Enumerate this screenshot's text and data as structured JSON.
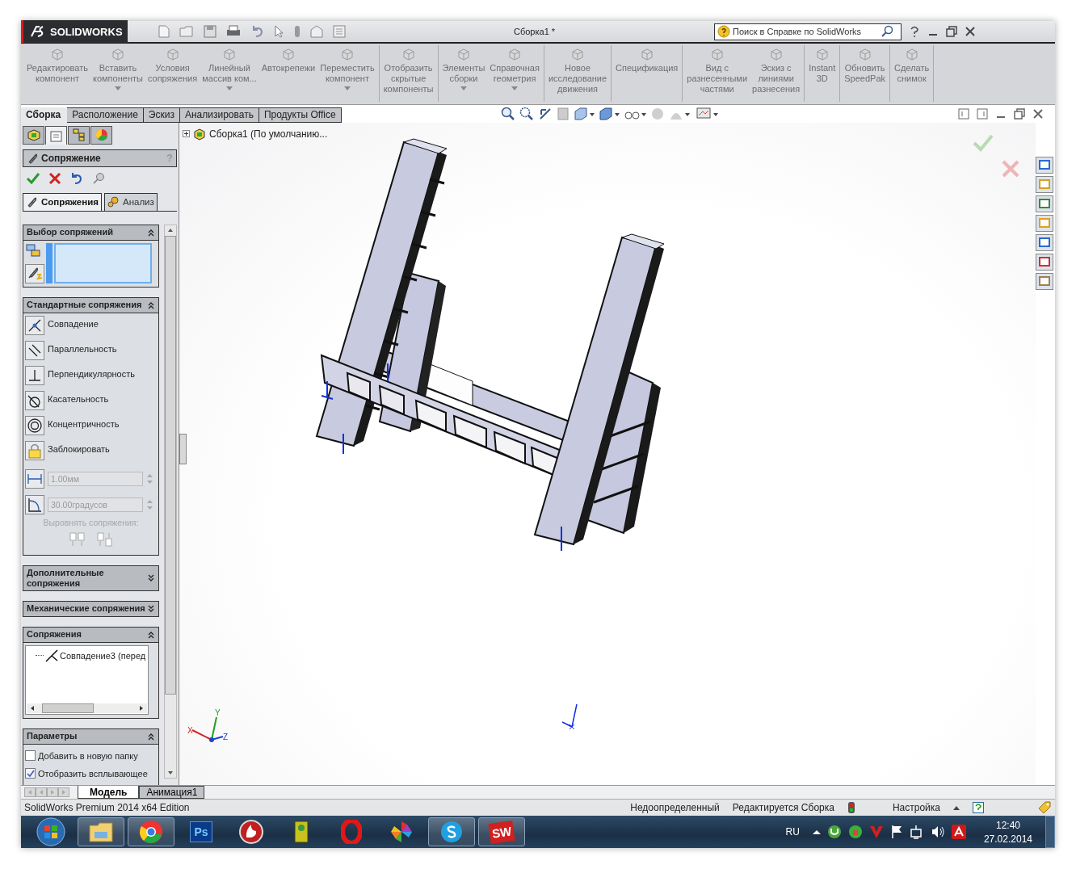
{
  "app_logo": "SOLIDWORKS",
  "window": {
    "title": "Сборка1 *"
  },
  "help_search": {
    "placeholder": "Поиск в Справке по SolidWorks"
  },
  "ribbon": [
    [
      {
        "label": "Редактировать\nкомпонент",
        "dropdown": false
      },
      {
        "label": "Вставить\nкомпоненты",
        "dropdown": true
      },
      {
        "label": "Условия\nсопряжения",
        "dropdown": false
      },
      {
        "label": "Линейный\nмассив ком...",
        "dropdown": true
      },
      {
        "label": "Автокрепежи",
        "dropdown": false
      },
      {
        "label": "Переместить\nкомпонент",
        "dropdown": true
      }
    ],
    [
      {
        "label": "Отобразить\nскрытые\nкомпоненты",
        "dropdown": false
      }
    ],
    [
      {
        "label": "Элементы\nсборки",
        "dropdown": true
      },
      {
        "label": "Справочная\nгеометрия",
        "dropdown": true
      }
    ],
    [
      {
        "label": "Новое\nисследование\nдвижения",
        "dropdown": false
      }
    ],
    [
      {
        "label": "Спецификация",
        "dropdown": false
      }
    ],
    [
      {
        "label": "Вид с\nразнесенными\nчастями",
        "dropdown": false
      },
      {
        "label": "Эскиз с\nлиниями\nразнесения",
        "dropdown": false
      }
    ],
    [
      {
        "label": "Instant\n3D",
        "dropdown": false
      }
    ],
    [
      {
        "label": "Обновить\nSpeedPak",
        "dropdown": false
      }
    ],
    [
      {
        "label": "Сделать\nснимок",
        "dropdown": false
      }
    ]
  ],
  "tabs": [
    {
      "label": "Сборка",
      "selected": true
    },
    {
      "label": "Расположение",
      "selected": false
    },
    {
      "label": "Эскиз",
      "selected": false
    },
    {
      "label": "Анализировать",
      "selected": false
    },
    {
      "label": "Продукты Office",
      "selected": false
    }
  ],
  "manager_tabs": [
    {
      "kind": "features",
      "selected": false
    },
    {
      "kind": "property",
      "selected": true
    },
    {
      "kind": "config",
      "selected": false
    },
    {
      "kind": "display",
      "selected": false
    }
  ],
  "property_manager": {
    "title": "Сопряжение",
    "help": "?",
    "panel_tabs": [
      {
        "label": "Сопряжения",
        "selected": true
      },
      {
        "label": "Анализ",
        "selected": false
      }
    ],
    "sections": [
      {
        "kind": "selection",
        "title": "Выбор сопряжений",
        "expanded": true
      },
      {
        "kind": "standard",
        "title": "Стандартные сопряжения",
        "expanded": true,
        "mates": [
          {
            "kind": "coincident",
            "label": "Совпадение"
          },
          {
            "kind": "parallel",
            "label": "Параллельность"
          },
          {
            "kind": "perpendicular",
            "label": "Перпендикулярность"
          },
          {
            "kind": "tangent",
            "label": "Касательность"
          },
          {
            "kind": "concentric",
            "label": "Концентричность"
          },
          {
            "kind": "lock",
            "label": "Заблокировать"
          }
        ],
        "fields": [
          {
            "kind": "distance",
            "value": "1.00мм",
            "disabled": true
          },
          {
            "kind": "angle",
            "value": "30.00градусов",
            "disabled": true
          }
        ],
        "align_label": "Выровнять сопряжения:"
      },
      {
        "title": "Дополнительные\nсопряжения",
        "expanded": false
      },
      {
        "title": "Механические сопряжения",
        "expanded": false
      },
      {
        "kind": "mates_list",
        "title": "Сопряжения",
        "expanded": true,
        "items": [
          {
            "label": "Совпадение3 (перед"
          }
        ]
      },
      {
        "kind": "options",
        "title": "Параметры",
        "expanded": true,
        "options": [
          {
            "label": "Добавить в новую папку",
            "checked": false
          },
          {
            "label": "Отобразить всплывающее",
            "checked": true
          }
        ]
      }
    ]
  },
  "feature_tree": {
    "label": "Сборка1  (По умолчанию...",
    "expanded": false
  },
  "axes": [
    "X",
    "Y",
    "Z"
  ],
  "bottom_tabs": [
    {
      "label": "Модель",
      "selected": true
    },
    {
      "label": "Анимация1",
      "selected": false
    }
  ],
  "status_bar": {
    "edition": "SolidWorks Premium 2014 x64 Edition",
    "state": "Недоопределенный",
    "mode": "Редактируется Сборка",
    "units": "Настройка"
  },
  "taskbar": {
    "apps": [
      {
        "kind": "start",
        "active": false
      },
      {
        "kind": "explorer",
        "active": true
      },
      {
        "kind": "chrome",
        "active": true
      },
      {
        "kind": "photoshop",
        "label": "Ps",
        "active": false
      },
      {
        "kind": "burn",
        "active": false
      },
      {
        "kind": "qip",
        "active": false
      },
      {
        "kind": "opera",
        "active": false
      },
      {
        "kind": "pinwheel",
        "active": false
      },
      {
        "kind": "skype",
        "active": true
      },
      {
        "kind": "solidworks",
        "label": "SW",
        "active": true
      }
    ],
    "language": "RU",
    "time": "12:40",
    "date": "27.02.2014"
  }
}
